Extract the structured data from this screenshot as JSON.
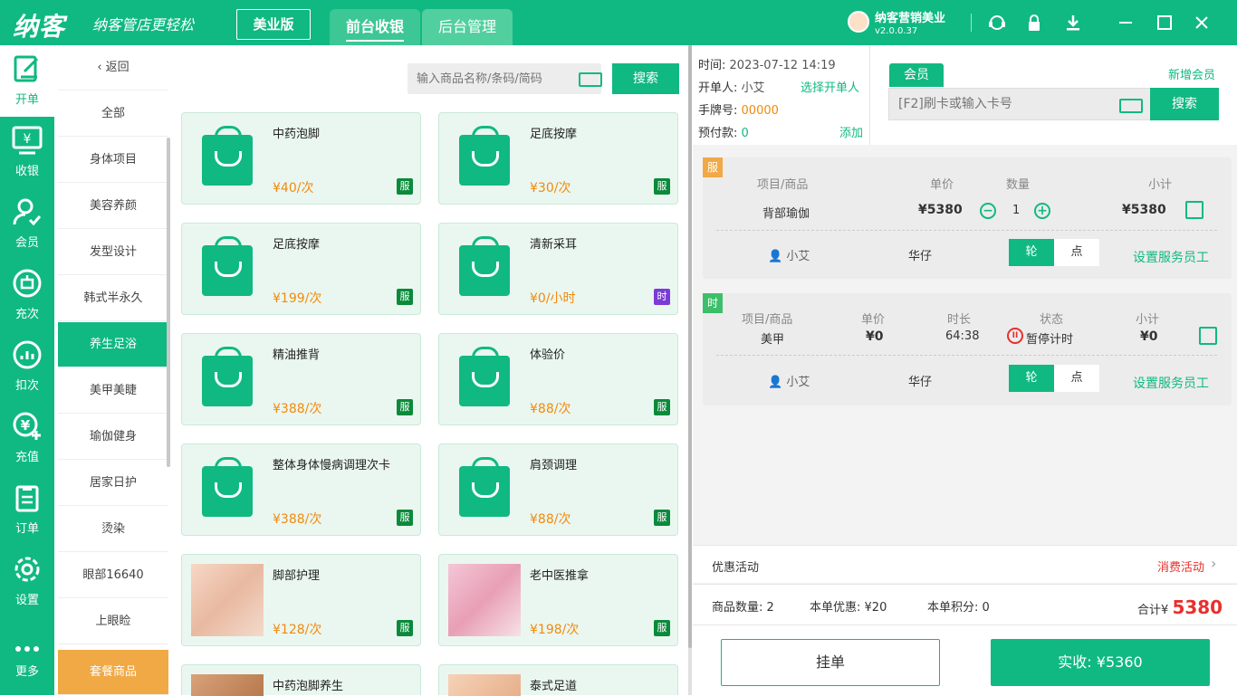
{
  "app": {
    "logo": "纳客",
    "slogan": "纳客管店更轻松",
    "edition": "美业版"
  },
  "top_tabs": [
    {
      "label": "前台收银"
    },
    {
      "label": "后台管理"
    }
  ],
  "user": {
    "name": "纳客营销美业",
    "version": "v2.0.0.37"
  },
  "sidebar": [
    {
      "label": "开单",
      "icon": "edit-icon"
    },
    {
      "label": "收银",
      "icon": "monitor-yen-icon"
    },
    {
      "label": "会员",
      "icon": "member-icon"
    },
    {
      "label": "充次",
      "icon": "recharge-times-icon"
    },
    {
      "label": "扣次",
      "icon": "chart-icon"
    },
    {
      "label": "充值",
      "icon": "yen-plus-icon"
    },
    {
      "label": "订单",
      "icon": "clipboard-icon"
    },
    {
      "label": "设置",
      "icon": "gear-icon"
    },
    {
      "label": "更多",
      "icon": "more-icon"
    }
  ],
  "categories": {
    "back": "返回",
    "items": [
      "全部",
      "身体项目",
      "美容养颜",
      "发型设计",
      "韩式半永久",
      "养生足浴",
      "美甲美睫",
      "瑜伽健身",
      "居家日护",
      "烫染",
      "眼部16640",
      "上眼睑",
      "套餐商品"
    ]
  },
  "search": {
    "placeholder": "输入商品名称/条码/简码",
    "button": "搜索"
  },
  "products": [
    {
      "name": "中药泡脚",
      "price": "¥40/次",
      "tag": "服"
    },
    {
      "name": "足底按摩",
      "price": "¥30/次",
      "tag": "服"
    },
    {
      "name": "足底按摩",
      "price": "¥199/次",
      "tag": "服"
    },
    {
      "name": "清新采耳",
      "price": "¥0/小时",
      "tag": "时"
    },
    {
      "name": "精油推背",
      "price": "¥388/次",
      "tag": "服"
    },
    {
      "name": "体验价",
      "price": "¥88/次",
      "tag": "服"
    },
    {
      "name": "整体身体慢病调理次卡",
      "price": "¥388/次",
      "tag": "服"
    },
    {
      "name": "肩颈调理",
      "price": "¥88/次",
      "tag": "服"
    },
    {
      "name": "脚部护理",
      "price": "¥128/次",
      "tag": "服"
    },
    {
      "name": "老中医推拿",
      "price": "¥198/次",
      "tag": "服"
    },
    {
      "name": "中药泡脚养生",
      "price": "",
      "tag": ""
    },
    {
      "name": "泰式足道",
      "price": "",
      "tag": ""
    }
  ],
  "order_info": {
    "time_label": "时间:",
    "time": "2023-07-12 14:19",
    "opener_label": "开单人:",
    "opener": "小艾",
    "choose_opener": "选择开单人",
    "plate_label": "手牌号:",
    "plate": "00000",
    "prepay_label": "预付款:",
    "prepay": "0",
    "add": "添加"
  },
  "member": {
    "tab": "会员",
    "new": "新增会员",
    "placeholder": "[F2]刷卡或输入卡号",
    "button": "搜索"
  },
  "order1": {
    "badge": "服",
    "h_item": "项目/商品",
    "h_price": "单价",
    "h_qty": "数量",
    "h_sub": "小计",
    "item": "背部瑜伽",
    "price": "¥5380",
    "qty": "1",
    "subtotal": "¥5380",
    "staff": "小艾",
    "staff2": "华仔",
    "seg_a": "轮",
    "seg_b": "点",
    "set_staff": "设置服务员工"
  },
  "order2": {
    "badge": "时",
    "h_item": "项目/商品",
    "h_price": "单价",
    "h_dur": "时长",
    "h_state": "状态",
    "h_sub": "小计",
    "item": "美甲",
    "price": "¥0",
    "duration": "64:38",
    "state": "暂停计时",
    "subtotal": "¥0",
    "staff": "小艾",
    "staff2": "华仔",
    "seg_a": "轮",
    "seg_b": "点",
    "set_staff": "设置服务员工"
  },
  "promo": {
    "label": "优惠活动",
    "link": "消费活动"
  },
  "summary": {
    "count_label": "商品数量:",
    "count": "2",
    "discount_label": "本单优惠:",
    "discount": "¥20",
    "points_label": "本单积分:",
    "points": "0",
    "total_label": "合计",
    "total_cur": "¥",
    "total": "5380"
  },
  "footer": {
    "hold": "挂单",
    "pay_label": "实收:",
    "pay": "¥5360"
  },
  "colors": {
    "brand": "#10b981",
    "price": "#f28a0c",
    "combo": "#f0a945",
    "time_tag": "#7b3bd6",
    "total": "#e8302d"
  }
}
